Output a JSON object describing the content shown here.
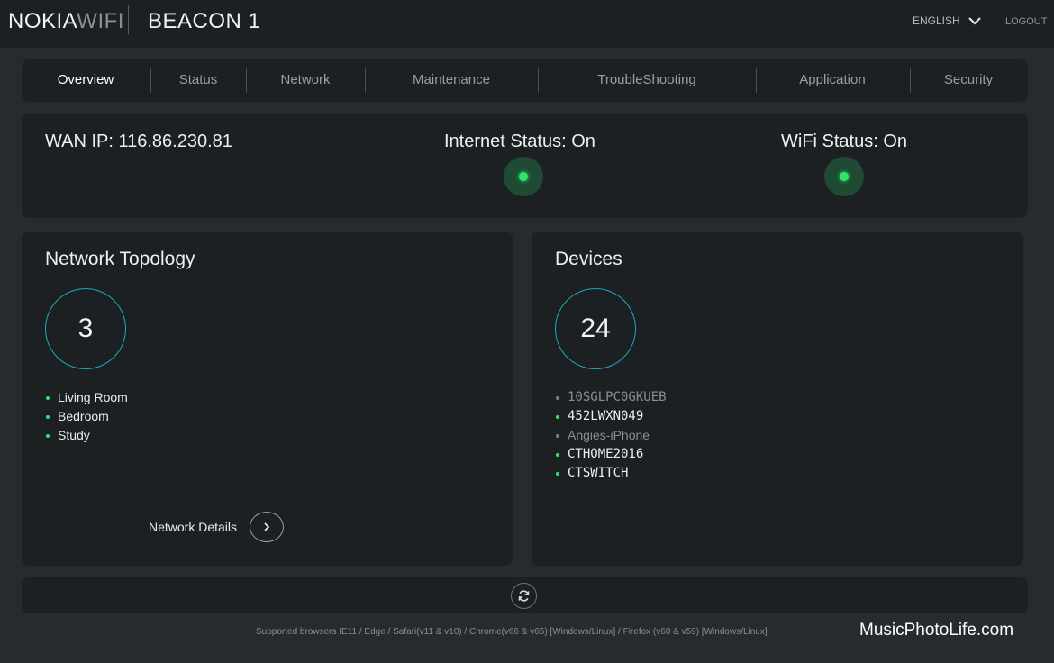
{
  "header": {
    "brand_part1": "NOKIA",
    "brand_part2": "WIFI",
    "device_name": "BEACON 1",
    "language": "ENGLISH",
    "logout": "LOGOUT"
  },
  "nav": {
    "tabs": [
      {
        "label": "Overview",
        "active": true
      },
      {
        "label": "Status"
      },
      {
        "label": "Network"
      },
      {
        "label": "Maintenance"
      },
      {
        "label": "TroubleShooting"
      },
      {
        "label": "Application"
      },
      {
        "label": "Security"
      }
    ]
  },
  "wan": {
    "wan_ip": "WAN IP: 116.86.230.81",
    "internet_status": "Internet Status: On",
    "wifi_status": "WiFi Status: On"
  },
  "topology": {
    "title": "Network Topology",
    "count": "3",
    "items": [
      "Living Room",
      "Bedroom",
      "Study"
    ],
    "details_label": "Network Details"
  },
  "devices": {
    "title": "Devices",
    "count": "24",
    "items": [
      {
        "name": "10SGLPC0GKUEB",
        "online": false
      },
      {
        "name": "452LWXN049",
        "online": true
      },
      {
        "name": "Angies-iPhone",
        "online": false
      },
      {
        "name": "CTHOME2016",
        "online": true
      },
      {
        "name": "CTSWITCH",
        "online": true
      }
    ]
  },
  "footer": {
    "supported": "Supported browsers IE11 / Edge / Safari(v11 & v10) / Chrome(v66 & v65) [Windows/Linux] / Firefox (v60 & v59) [Windows/Linux]"
  },
  "watermark": "MusicPhotoLife.com",
  "colors": {
    "accent_ring": "#1fa8b8",
    "status_on": "#2ee56a",
    "panel": "#1c2023",
    "background": "#262b2e"
  }
}
